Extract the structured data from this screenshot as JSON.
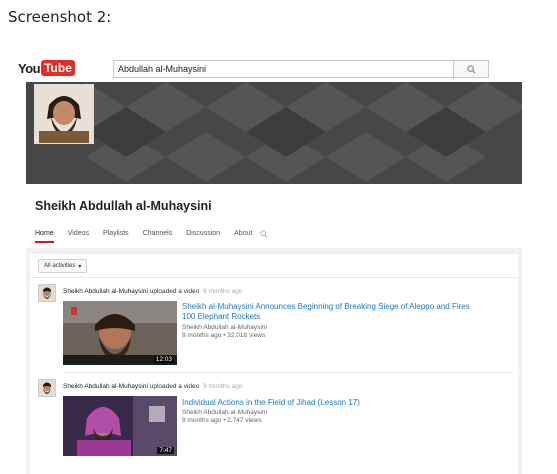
{
  "caption": "Screenshot 2:",
  "header": {
    "logo_you": "You",
    "logo_tube": "Tube",
    "search_value": "Abdullah al-Muhaysini"
  },
  "channel": {
    "title": "Sheikh Abdullah al-Muhaysini",
    "tabs": [
      "Home",
      "Videos",
      "Playlists",
      "Channels",
      "Discussion",
      "About"
    ]
  },
  "feed": {
    "filter_label": "All activities",
    "items": [
      {
        "uploader": "Sheikh Abdullah al-Muhaysini",
        "action": "uploaded a video",
        "ago": "9 months ago",
        "video_title": "Sheikh al-Muhaysini Announces Beginning of Breaking Siege of Aleppo and Fires 100 Elephant Rockets",
        "channel": "Sheikh Abdullah al-Muhaysini",
        "stats": "9 months ago • 32,018 views",
        "duration": "12:03"
      },
      {
        "uploader": "Sheikh Abdullah al-Muhaysini",
        "action": "uploaded a video",
        "ago": "9 months ago",
        "video_title": "Individual Actions in the Field of Jihad (Lesson 17)",
        "channel": "Sheikh Abdullah al-Muhaysini",
        "stats": "9 months ago • 2,747 views",
        "duration": "7:47"
      }
    ]
  },
  "colors": {
    "brand_red": "#e52d27",
    "link_blue": "#167ac6",
    "banner_gray": "#4a4a4a"
  }
}
